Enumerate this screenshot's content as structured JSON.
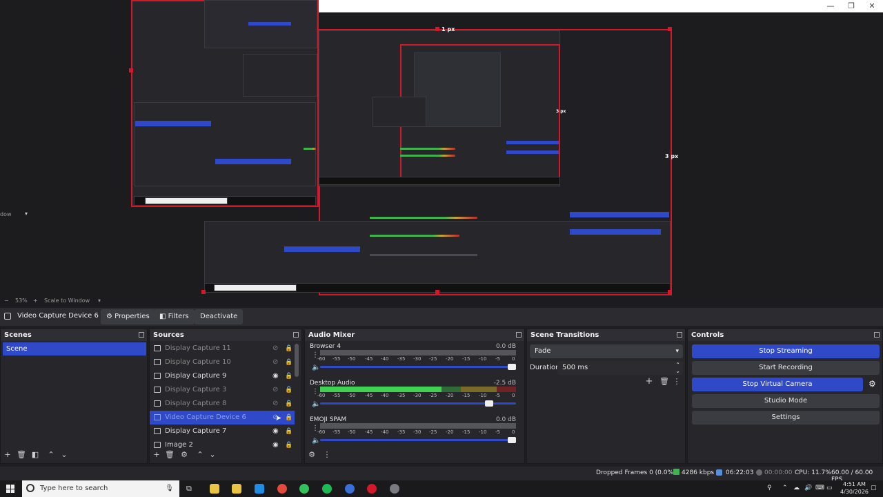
{
  "preview": {
    "nested_labels": [
      "1 px",
      "3 px",
      "3 px"
    ],
    "zoom": "53%",
    "scale_mode": "Scale to Window",
    "left_stub": "dow"
  },
  "window_controls": [
    "—",
    "❐",
    "✕"
  ],
  "source_toolbar": {
    "current_source": "Video Capture Device 6",
    "properties_label": "Properties",
    "filters_label": "Filters",
    "deactivate_label": "Deactivate"
  },
  "scenes": {
    "title": "Scenes",
    "items": [
      {
        "label": "Scene",
        "selected": true
      }
    ]
  },
  "sources": {
    "title": "Sources",
    "items": [
      {
        "label": "Display Capture 11",
        "visible": false,
        "selected": false
      },
      {
        "label": "Display Capture 10",
        "visible": false,
        "selected": false
      },
      {
        "label": "Display Capture 9",
        "visible": true,
        "selected": false
      },
      {
        "label": "Display Capture 3",
        "visible": false,
        "selected": false
      },
      {
        "label": "Display Capture 8",
        "visible": false,
        "selected": false
      },
      {
        "label": "Video Capture Device 6",
        "visible": false,
        "selected": true
      },
      {
        "label": "Display Capture 7",
        "visible": true,
        "selected": false
      },
      {
        "label": "Image 2",
        "visible": true,
        "selected": false
      }
    ]
  },
  "audio_mixer": {
    "title": "Audio Mixer",
    "ticks": [
      "-60",
      "-55",
      "-50",
      "-45",
      "-40",
      "-35",
      "-30",
      "-25",
      "-20",
      "-15",
      "-10",
      "-5",
      "0"
    ],
    "channels": [
      {
        "name": "Browser 4",
        "db": "0.0 dB",
        "level": 0.0,
        "volume": 1.0
      },
      {
        "name": "Desktop Audio",
        "db": "-2.5 dB",
        "level": 0.62,
        "volume": 0.88
      },
      {
        "name": "EMOJI SPAM",
        "db": "0.0 dB",
        "level": 0.0,
        "volume": 1.0
      }
    ]
  },
  "scene_transitions": {
    "title": "Scene Transitions",
    "transition": "Fade",
    "duration_label": "Duration",
    "duration_value": "500 ms"
  },
  "controls": {
    "title": "Controls",
    "stop_streaming": "Stop Streaming",
    "start_recording": "Start Recording",
    "stop_virtual_camera": "Stop Virtual Camera",
    "studio_mode": "Studio Mode",
    "settings": "Settings"
  },
  "status": {
    "dropped_frames": "Dropped Frames 0 (0.0%)",
    "bitrate": "4286 kbps",
    "stream_time": "06:22:03",
    "record_time": "00:00:00",
    "cpu": "CPU: 11.7%",
    "fps": "60.00 / 60.00 FPS"
  },
  "taskbar": {
    "search_placeholder": "Type here to search",
    "time": "4:51 AM",
    "date": "4/30/2026",
    "colors": [
      "#e8c547",
      "#e8c547",
      "#1e8de3",
      "#e24a3b",
      "#33c25a",
      "#1db954",
      "#3a6fd8",
      "#d3182b",
      "#7a7a82"
    ]
  }
}
